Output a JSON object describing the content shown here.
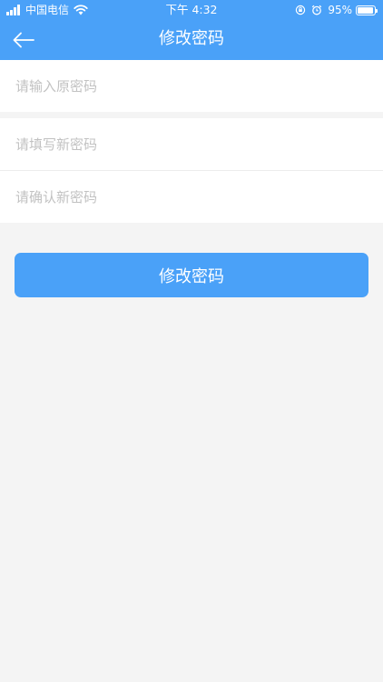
{
  "status_bar": {
    "carrier": "中国电信",
    "time": "下午 4:32",
    "battery_percent": "95%",
    "battery_level": 0.95,
    "icons": [
      "signal-icon",
      "wifi-icon",
      "orientation-lock-icon",
      "alarm-icon",
      "battery-icon"
    ]
  },
  "nav": {
    "title": "修改密码",
    "back_icon": "arrow-left-icon"
  },
  "form": {
    "old_password": {
      "placeholder": "请输入原密码",
      "value": ""
    },
    "new_password": {
      "placeholder": "请填写新密码",
      "value": ""
    },
    "confirm_password": {
      "placeholder": "请确认新密码",
      "value": ""
    },
    "submit_label": "修改密码"
  },
  "colors": {
    "primary": "#4aa1f8",
    "background": "#f4f4f4",
    "placeholder": "#c2c2c2"
  }
}
